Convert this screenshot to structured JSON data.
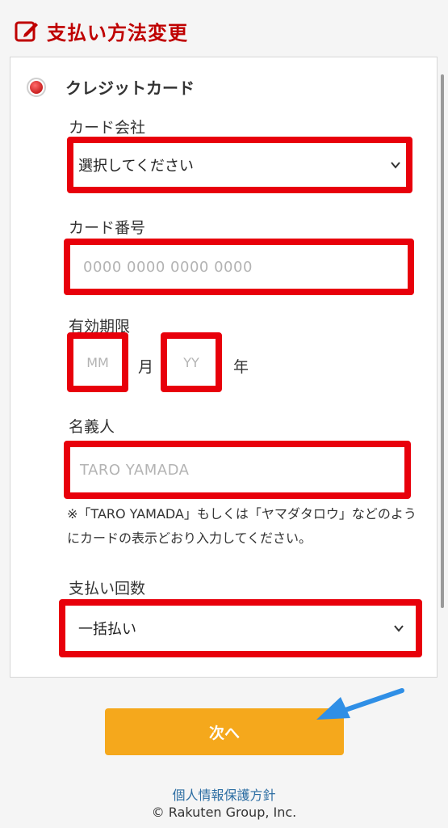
{
  "header": {
    "title": "支払い方法変更",
    "icon": "edit-icon"
  },
  "payment_option": {
    "label": "クレジットカード",
    "selected": true
  },
  "card_company": {
    "label": "カード会社",
    "value": "選択してください"
  },
  "card_number": {
    "label": "カード番号",
    "placeholder": "0000 0000 0000 0000"
  },
  "expiry": {
    "label": "有効期限",
    "month_placeholder": "MM",
    "month_unit": "月",
    "year_placeholder": "YY",
    "year_unit": "年"
  },
  "holder": {
    "label": "名義人",
    "placeholder": "TARO YAMADA",
    "note": "※「TARO YAMADA」もしくは「ヤマダタロウ」などのようにカードの表示どおり入力してください。"
  },
  "installments": {
    "label": "支払い回数",
    "value": "一括払い"
  },
  "next_button": {
    "label": "次へ"
  },
  "footer": {
    "privacy_link": "個人情報保護方針",
    "copyright": "© Rakuten Group, Inc."
  },
  "colors": {
    "brand_red": "#bf0000",
    "highlight_red": "#e8000b",
    "button_orange": "#f5a81c",
    "arrow_blue": "#2f8fe6",
    "link_blue": "#2d6ea3"
  }
}
